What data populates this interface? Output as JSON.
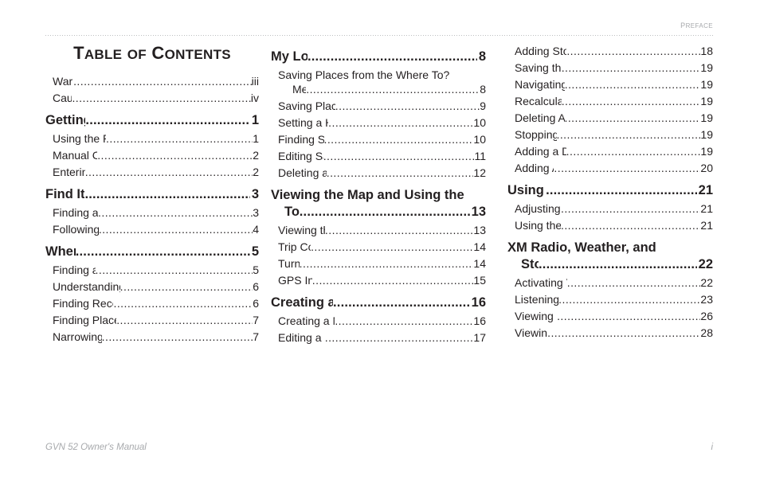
{
  "header": {
    "running_head": "Preface"
  },
  "title": {
    "part1_big": "T",
    "part1_small": "ABLE",
    "part2_small": "OF",
    "part3_big": "C",
    "part3_small": "ONTENTS",
    "full_text": "Table of Contents"
  },
  "footer": {
    "left": "GVN 52 Owner's Manual",
    "right": "i"
  },
  "columns": [
    {
      "id": "col1",
      "entries": [
        {
          "type": "sub",
          "label": "Warning",
          "page": "iii"
        },
        {
          "type": "sub",
          "label": "Caution",
          "page": "iv"
        },
        {
          "type": "chapter",
          "label": "Getting Started",
          "page": "1"
        },
        {
          "type": "sub",
          "label": "Using the Remote Control",
          "page": "1"
        },
        {
          "type": "sub",
          "label": "Manual Conventions ",
          "page": "2"
        },
        {
          "type": "sub",
          "label": "Entering Data",
          "page": "2"
        },
        {
          "type": "chapter",
          "label": "Find It and Go! ",
          "page": "3"
        },
        {
          "type": "sub",
          "label": "Finding a Restaurant ",
          "page": "3"
        },
        {
          "type": "sub",
          "label": "Following Your Route ",
          "page": "4"
        },
        {
          "type": "chapter",
          "label": "Where To? ",
          "page": "5"
        },
        {
          "type": "sub",
          "label": "Finding an Address  ",
          "page": "5"
        },
        {
          "type": "sub",
          "label": "Understanding the Information Page ",
          "page": "6"
        },
        {
          "type": "sub",
          "label": "Finding Recently Found Places  ",
          "page": "6"
        },
        {
          "type": "sub",
          "label": "Finding Places in a Different Area",
          "page": "7"
        },
        {
          "type": "sub",
          "label": "Narrowing Your Search ",
          "page": "7"
        }
      ]
    },
    {
      "id": "col2",
      "entries": [
        {
          "type": "chapter",
          "label": "My Locations ",
          "page": "8"
        },
        {
          "type": "sub-wrap",
          "line1": "Saving Places from the Where To?",
          "label": "Menu",
          "page": "8"
        },
        {
          "type": "sub",
          "label": "Saving Places from the Map",
          "page": "9"
        },
        {
          "type": "sub",
          "label": "Setting a Home Location",
          "page": "10"
        },
        {
          "type": "sub",
          "label": "Finding Saved Places ",
          "page": "10"
        },
        {
          "type": "sub",
          "label": "Editing Saved Places ",
          "page": "11"
        },
        {
          "type": "sub",
          "label": "Deleting a Saved Place",
          "page": "12"
        },
        {
          "type": "chapter-wrap",
          "line1": "Viewing the Map and Using the",
          "label": "Tools ",
          "page": "13"
        },
        {
          "type": "sub",
          "label": "Viewing the Map Page ",
          "page": "13"
        },
        {
          "type": "sub",
          "label": "Trip Computer ",
          "page": "14"
        },
        {
          "type": "sub",
          "label": "Turn List ",
          "page": "14"
        },
        {
          "type": "sub",
          "label": "GPS Info Page ",
          "page": "15"
        },
        {
          "type": "chapter",
          "label": "Creating and Editing Routes ",
          "page": "16"
        },
        {
          "type": "sub",
          "label": "Creating a New Saved Route",
          "page": "16"
        },
        {
          "type": "sub",
          "label": "Editing a Saved Route ",
          "page": "17"
        }
      ]
    },
    {
      "id": "col3",
      "entries": [
        {
          "type": "sub",
          "label": "Adding Stops to Your Route",
          "page": "18"
        },
        {
          "type": "sub",
          "label": "Saving the Active Route",
          "page": "19"
        },
        {
          "type": "sub",
          "label": "Navigating a Saved Route ",
          "page": "19"
        },
        {
          "type": "sub",
          "label": "Recalculating the Route",
          "page": "19"
        },
        {
          "type": "sub",
          "label": "Deleting All Saved Routes",
          "page": "19"
        },
        {
          "type": "sub",
          "label": "Stopping Your Route ",
          "page": "19"
        },
        {
          "type": "sub",
          "label": "Adding a Detour to a Route",
          "page": "19"
        },
        {
          "type": "sub",
          "label": "Adding Avoidances",
          "page": "20"
        },
        {
          "type": "chapter",
          "label": "Using The Logs",
          "page": "21"
        },
        {
          "type": "sub",
          "label": "Adjusting the Track Log",
          "page": "21"
        },
        {
          "type": "sub",
          "label": "Using the Mileage Logs",
          "page": "21"
        },
        {
          "type": "chapter-wrap",
          "line1": "XM Radio, Weather, and",
          "label": "Stocks",
          "page": "22"
        },
        {
          "type": "sub",
          "label": "Activating Your Subscription",
          "page": "22"
        },
        {
          "type": "sub",
          "label": "Listening to XM Radio ",
          "page": "23"
        },
        {
          "type": "sub",
          "label": "Viewing XM Weather",
          "page": "26"
        },
        {
          "type": "sub",
          "label": "Viewing Stocks",
          "page": "28"
        }
      ]
    }
  ]
}
